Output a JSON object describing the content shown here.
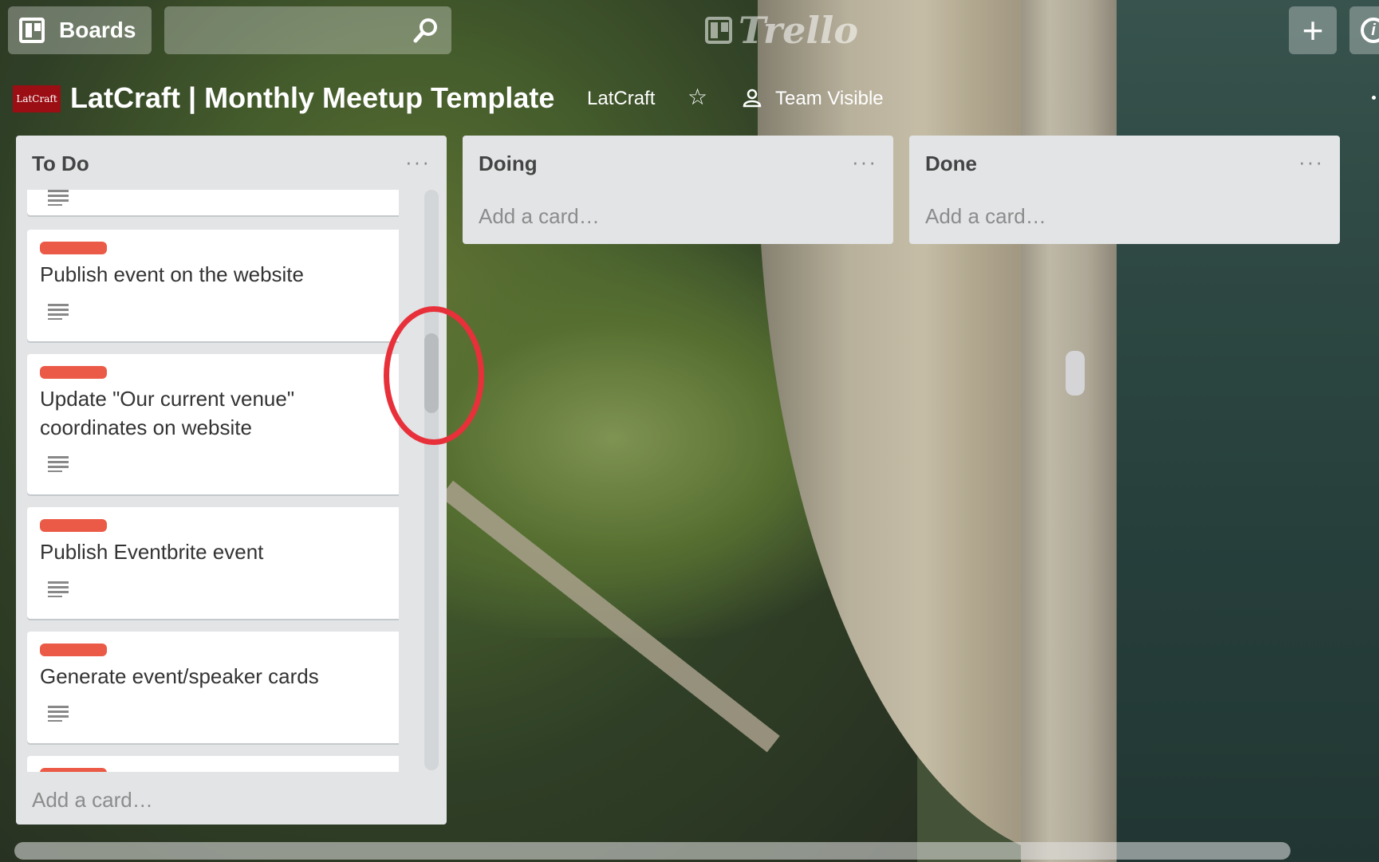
{
  "header": {
    "boards_label": "Boards",
    "logo_text": "Trello",
    "add_label": "+",
    "info_label": "i"
  },
  "board": {
    "org_logo_text": "LatCraft",
    "title": "LatCraft | Monthly Meetup Template",
    "org": "LatCraft",
    "visibility": "Team Visible"
  },
  "lists": [
    {
      "title": "To Do",
      "menu": "···",
      "add_card": "Add a card…",
      "cards": [
        {
          "title": ""
        },
        {
          "title": "Publish event on the website"
        },
        {
          "title": "Update \"Our current venue\" coordinates on website"
        },
        {
          "title": "Publish Eventbrite event"
        },
        {
          "title": "Generate event/speaker cards"
        }
      ]
    },
    {
      "title": "Doing",
      "menu": "···",
      "add_card": "Add a card…"
    },
    {
      "title": "Done",
      "menu": "···",
      "add_card": "Add a card…"
    }
  ],
  "colors": {
    "label_red": "#eb5a46",
    "list_bg": "#e2e4e6",
    "annotation_red": "#e8303a"
  }
}
